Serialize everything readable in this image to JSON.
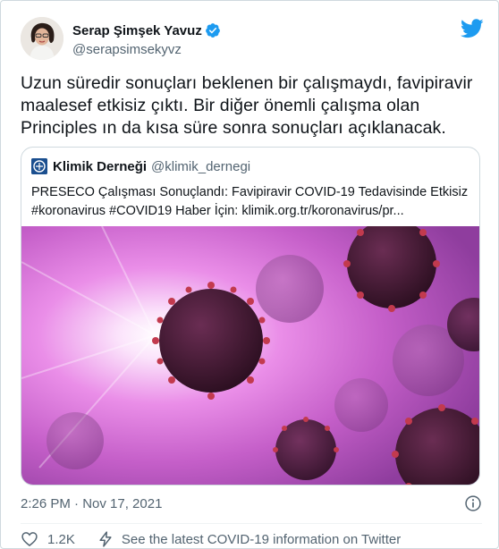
{
  "author": {
    "name": "Serap Şimşek Yavuz",
    "handle": "@serapsimsekyvz"
  },
  "tweet": {
    "lines": [
      "Uzun süredir sonuçları beklenen bir çalışmaydı, favipiravir",
      "maalesef etkisiz çıktı. Bir diğer önemli çalışma olan",
      "Principles ın da kısa süre sonra sonuçları açıklanacak."
    ]
  },
  "quoted": {
    "name": "Klimik Derneği",
    "handle": "@klimik_dernegi",
    "line1": "PRESECO Çalışması Sonuçlandı: Favipiravir COVID-19 Tedavisinde Etkisiz",
    "line2": "#koronavirus #COVID19 Haber İçin: klimik.org.tr/koronavirus/pr..."
  },
  "meta": {
    "timestamp": "2:26 PM · Nov 17, 2021"
  },
  "actions": {
    "like_count": "1.2K",
    "covid_link": "See the latest COVID-19 information on Twitter"
  },
  "colors": {
    "twitter_blue": "#1d9bf0",
    "secondary_text": "#536471",
    "border": "#cfd9de"
  },
  "icons": {
    "verified": "verified-badge-icon",
    "brand": "twitter-bird-icon",
    "info": "info-icon",
    "like": "heart-icon",
    "covid": "lightning-icon"
  }
}
